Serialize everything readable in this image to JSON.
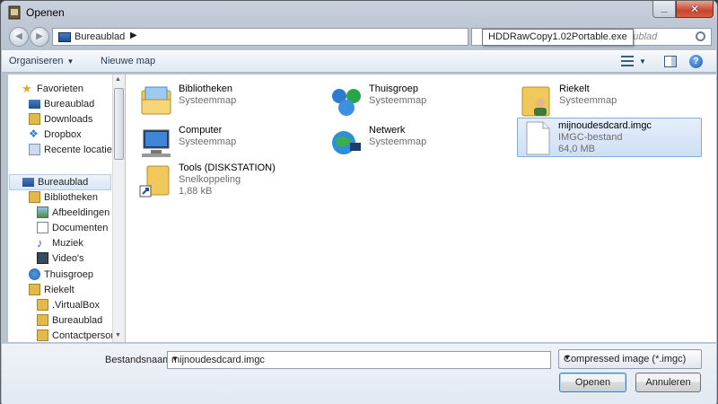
{
  "window": {
    "title": "Openen"
  },
  "address": {
    "crumb": "Bureaublad",
    "arrow": "▶"
  },
  "search": {
    "placeholder": "Bureaublad"
  },
  "tooltip": {
    "text": "HDDRawCopy1.02Portable.exe"
  },
  "toolbar": {
    "organise": "Organiseren",
    "new_folder": "Nieuwe map"
  },
  "nav": {
    "items": [
      {
        "label": "Favorieten"
      },
      {
        "label": "Bureaublad"
      },
      {
        "label": "Downloads"
      },
      {
        "label": "Dropbox"
      },
      {
        "label": "Recente locaties"
      },
      {
        "label": "Bureaublad"
      },
      {
        "label": "Bibliotheken"
      },
      {
        "label": "Afbeeldingen"
      },
      {
        "label": "Documenten"
      },
      {
        "label": "Muziek"
      },
      {
        "label": "Video's"
      },
      {
        "label": "Thuisgroep"
      },
      {
        "label": "Riekelt"
      },
      {
        "label": ".VirtualBox"
      },
      {
        "label": "Bureaublad"
      },
      {
        "label": "Contactperson"
      }
    ]
  },
  "files": [
    {
      "name": "Bibliotheken",
      "sub": "Systeemmap",
      "size": ""
    },
    {
      "name": "Thuisgroep",
      "sub": "Systeemmap",
      "size": ""
    },
    {
      "name": "Riekelt",
      "sub": "Systeemmap",
      "size": ""
    },
    {
      "name": "Computer",
      "sub": "Systeemmap",
      "size": ""
    },
    {
      "name": "Netwerk",
      "sub": "Systeemmap",
      "size": ""
    },
    {
      "name": "mijnoudesdcard.imgc",
      "sub": "IMGC-bestand",
      "size": "64,0 MB"
    },
    {
      "name": "Tools (DISKSTATION)",
      "sub": "Snelkoppeling",
      "size": "1,88 kB"
    }
  ],
  "bottom": {
    "filename_label": "Bestandsnaam:",
    "filename_value": "mijnoudesdcard.imgc",
    "filter_value": "Compressed image (*.imgc)",
    "open_label": "Openen",
    "cancel_label": "Annuleren"
  },
  "colors": {
    "selection": "#cfdff4",
    "accent": "#1e395b",
    "close": "#c7452c"
  }
}
